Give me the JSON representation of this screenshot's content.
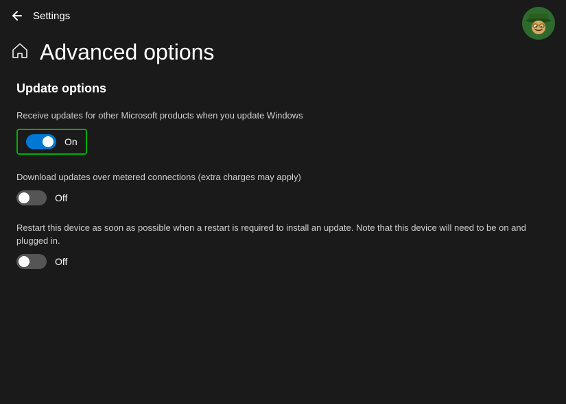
{
  "header": {
    "title": "Settings",
    "back_label": "←",
    "avatar_emoji": "🤠"
  },
  "page": {
    "home_icon": "⌂",
    "title": "Advanced options"
  },
  "update_options": {
    "section_title": "Update options",
    "options": [
      {
        "id": "receive-updates",
        "description": "Receive updates for other Microsoft products when you update Windows",
        "state": "on",
        "label": "On",
        "highlighted": true
      },
      {
        "id": "metered-connections",
        "description": "Download updates over metered connections (extra charges may apply)",
        "state": "off",
        "label": "Off",
        "highlighted": false
      },
      {
        "id": "restart-device",
        "description": "Restart this device as soon as possible when a restart is required to install an update. Note that this device will need to be on and plugged in.",
        "state": "off",
        "label": "Off",
        "highlighted": false
      }
    ]
  }
}
